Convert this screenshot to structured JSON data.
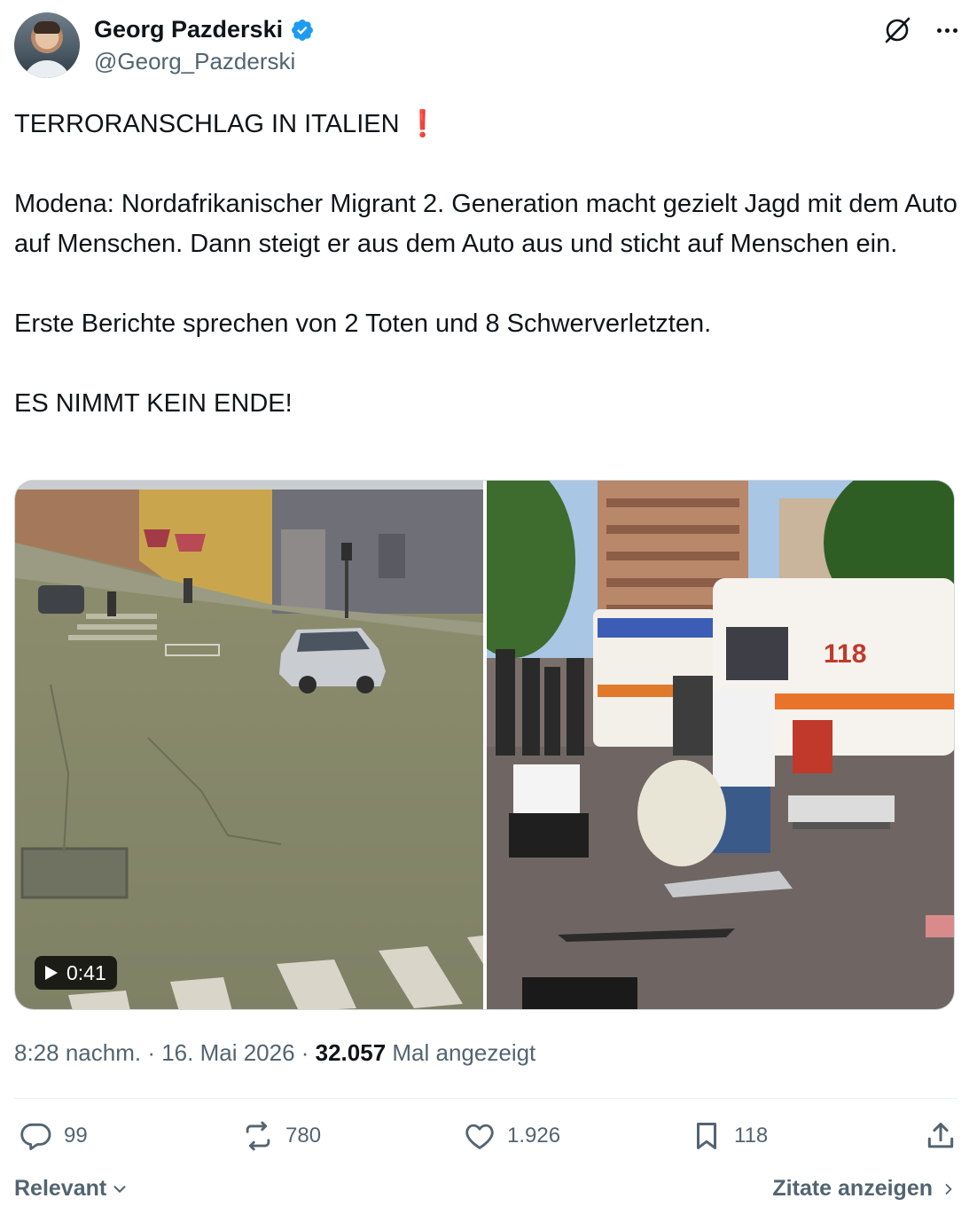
{
  "author": {
    "display_name": "Georg Pazderski",
    "handle": "@Georg_Pazderski",
    "verified": true
  },
  "tweet": {
    "line1": "TERRORANSCHLAG IN ITALIEN ",
    "emoji": "❗",
    "para2": "Modena: Nordafrikanischer Migrant 2. Generation macht gezielt Jagd mit dem Auto auf Menschen. Dann steigt er aus dem Auto aus und sticht auf Menschen ein.",
    "para3": "Erste Berichte sprechen von 2 Toten und 8 Schwerverletzten.",
    "para4": "ES NIMMT KEIN ENDE!"
  },
  "media": {
    "video_duration": "0:41"
  },
  "meta": {
    "time": "8:28 nachm.",
    "sep1": " · ",
    "date": "16. Mai 2026",
    "sep2": " · ",
    "views": "32.057",
    "views_label": " Mal angezeigt"
  },
  "actions": {
    "replies": "99",
    "reposts": "780",
    "likes": "1.926",
    "bookmarks": "118"
  },
  "footer": {
    "sort_label": "Relevant",
    "quotes_label": "Zitate anzeigen"
  },
  "colors": {
    "verified": "#1d9bf0",
    "text": "#0f1419",
    "muted": "#536471",
    "exclamation": "#d0021b"
  }
}
